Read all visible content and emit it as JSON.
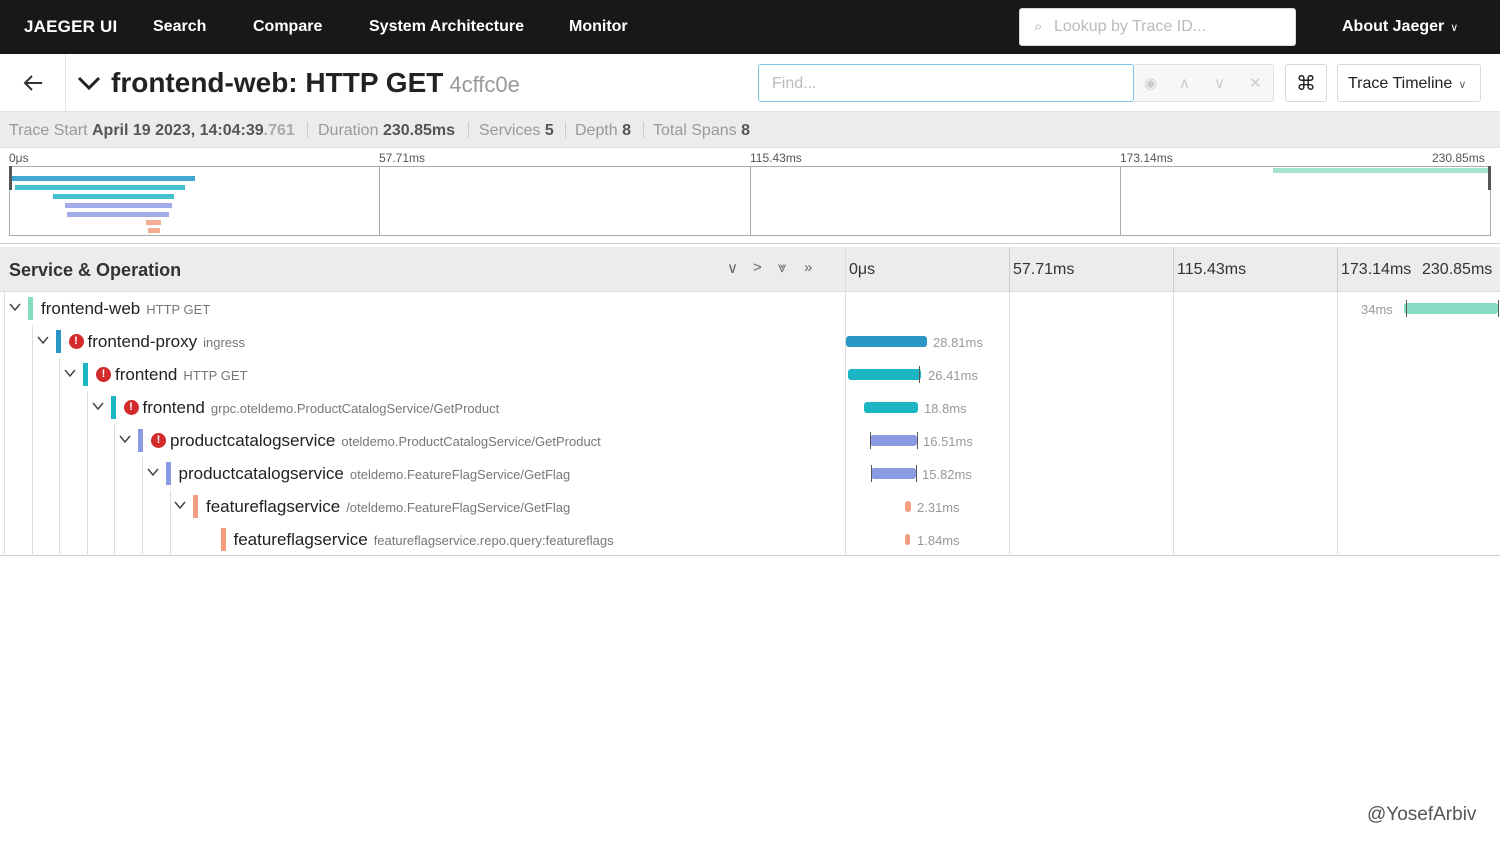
{
  "topnav": {
    "brand": "JAEGER UI",
    "links": [
      "Search",
      "Compare",
      "System Architecture",
      "Monitor"
    ],
    "lookup_placeholder": "Lookup by Trace ID...",
    "about": "About Jaeger"
  },
  "header": {
    "title": "frontend-web: HTTP GET",
    "trace_id": "4cffc0e",
    "find_placeholder": "Find...",
    "cmd_glyph": "⌘",
    "view_mode": "Trace Timeline"
  },
  "summary": {
    "start_label": "Trace Start",
    "start_value": "April 19 2023, 14:04:39",
    "start_ms": ".761",
    "duration_label": "Duration",
    "duration_value": "230.85ms",
    "services_label": "Services",
    "services_value": "5",
    "depth_label": "Depth",
    "depth_value": "8",
    "spans_label": "Total Spans",
    "spans_value": "8"
  },
  "minimap": {
    "ticks": [
      "0μs",
      "57.71ms",
      "115.43ms",
      "173.14ms",
      "230.85ms"
    ]
  },
  "grid": {
    "title": "Service & Operation",
    "ticks": [
      "0μs",
      "57.71ms",
      "115.43ms",
      "173.14ms",
      "230.85ms"
    ],
    "rows": [
      {
        "service": "frontend-web",
        "operation": "HTTP GET",
        "duration": "34ms",
        "error": false,
        "color": "#86dbc2"
      },
      {
        "service": "frontend-proxy",
        "operation": "ingress",
        "duration": "28.81ms",
        "error": true,
        "color": "#2b95c5"
      },
      {
        "service": "frontend",
        "operation": "HTTP GET",
        "duration": "26.41ms",
        "error": true,
        "color": "#1bb5c3"
      },
      {
        "service": "frontend",
        "operation": "grpc.oteldemo.ProductCatalogService/GetProduct",
        "duration": "18.8ms",
        "error": true,
        "color": "#1bb5c3"
      },
      {
        "service": "productcatalogservice",
        "operation": "oteldemo.ProductCatalogService/GetProduct",
        "duration": "16.51ms",
        "error": true,
        "color": "#8b9be3"
      },
      {
        "service": "productcatalogservice",
        "operation": "oteldemo.FeatureFlagService/GetFlag",
        "duration": "15.82ms",
        "error": false,
        "color": "#8b9be3"
      },
      {
        "service": "featureflagservice",
        "operation": "/oteldemo.FeatureFlagService/GetFlag",
        "duration": "2.31ms",
        "error": false,
        "color": "#f39c7e"
      },
      {
        "service": "featureflagservice",
        "operation": "featureflagservice.repo.query:featureflags",
        "duration": "1.84ms",
        "error": false,
        "color": "#f39c7e"
      }
    ]
  },
  "watermark": "@YosefArbiv"
}
